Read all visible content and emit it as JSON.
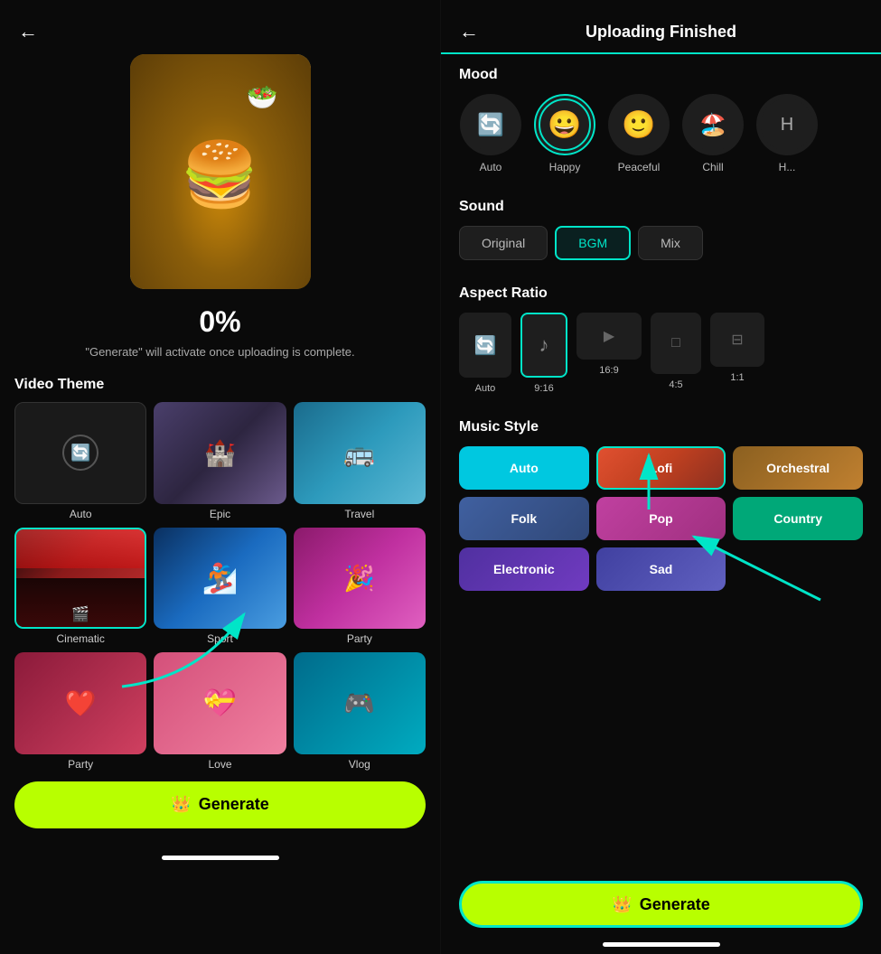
{
  "left": {
    "back_arrow": "←",
    "progress": "0%",
    "progress_hint": "\"Generate\" will activate once uploading is complete.",
    "section_title": "Video Theme",
    "themes": [
      {
        "id": "auto",
        "label": "Auto",
        "type": "auto"
      },
      {
        "id": "epic",
        "label": "Epic",
        "type": "epic"
      },
      {
        "id": "travel",
        "label": "Travel",
        "type": "travel"
      },
      {
        "id": "cinematic",
        "label": "Cinematic",
        "type": "cinematic",
        "selected": true
      },
      {
        "id": "sport",
        "label": "Sport",
        "type": "sport"
      },
      {
        "id": "party",
        "label": "Party",
        "type": "party"
      },
      {
        "id": "party2",
        "label": "Party",
        "type": "party2"
      },
      {
        "id": "love",
        "label": "Love",
        "type": "love"
      },
      {
        "id": "vlog",
        "label": "Vlog",
        "type": "vlog"
      }
    ],
    "generate_label": "Generate",
    "generate_icon": "👑"
  },
  "right": {
    "back_arrow": "←",
    "title": "Uploading Finished",
    "mood_section": "Mood",
    "mood_items": [
      {
        "id": "auto",
        "label": "Auto",
        "emoji": "🔄",
        "type": "icon"
      },
      {
        "id": "happy",
        "label": "Happy",
        "emoji": "😀",
        "selected": true
      },
      {
        "id": "peaceful",
        "label": "Peaceful",
        "emoji": "🙂"
      },
      {
        "id": "chill",
        "label": "Chill",
        "emoji": "🏖️"
      },
      {
        "id": "h",
        "label": "H...",
        "emoji": ""
      }
    ],
    "sound_section": "Sound",
    "sound_items": [
      {
        "id": "original",
        "label": "Original"
      },
      {
        "id": "bgm",
        "label": "BGM",
        "selected": true
      },
      {
        "id": "mix",
        "label": "Mix"
      }
    ],
    "ratio_section": "Aspect Ratio",
    "ratio_items": [
      {
        "id": "auto",
        "label": "Auto",
        "type": "auto"
      },
      {
        "id": "9:16",
        "label": "9:16",
        "type": "portrait",
        "selected": true
      },
      {
        "id": "16:9",
        "label": "16:9",
        "type": "landscape"
      },
      {
        "id": "4:5",
        "label": "4:5",
        "type": "four5"
      },
      {
        "id": "1:1",
        "label": "1:1",
        "type": "square"
      }
    ],
    "music_section": "Music Style",
    "music_items": [
      {
        "id": "auto",
        "label": "Auto",
        "style": "auto"
      },
      {
        "id": "lofi",
        "label": "Lofi",
        "style": "lofi",
        "selected": true
      },
      {
        "id": "orchestral",
        "label": "Orchestral",
        "style": "orchestral"
      },
      {
        "id": "folk",
        "label": "Folk",
        "style": "folk"
      },
      {
        "id": "pop",
        "label": "Pop",
        "style": "pop"
      },
      {
        "id": "country",
        "label": "Country",
        "style": "country"
      },
      {
        "id": "electronic",
        "label": "Electronic",
        "style": "electronic"
      },
      {
        "id": "sad",
        "label": "Sad",
        "style": "sad"
      }
    ],
    "generate_label": "Generate",
    "generate_icon": "👑"
  }
}
